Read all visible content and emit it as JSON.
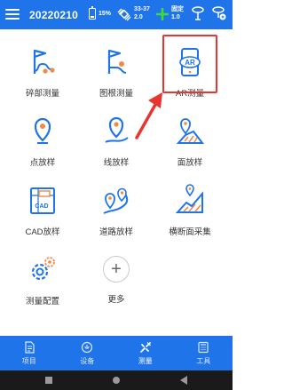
{
  "header": {
    "project_name": "20220210",
    "battery": "15%",
    "satellites": "33-37",
    "sat_value": "2.0",
    "fix_status": "固定",
    "fix_value": "1.0"
  },
  "grid": [
    {
      "label": "碎部测量",
      "icon": "detail-survey-icon"
    },
    {
      "label": "图根测量",
      "icon": "control-survey-icon"
    },
    {
      "label": "AR测量",
      "icon": "ar-survey-icon"
    },
    {
      "label": "点放样",
      "icon": "point-stakeout-icon"
    },
    {
      "label": "线放样",
      "icon": "line-stakeout-icon"
    },
    {
      "label": "面放样",
      "icon": "surface-stakeout-icon"
    },
    {
      "label": "CAD放样",
      "icon": "cad-stakeout-icon"
    },
    {
      "label": "道路放样",
      "icon": "road-stakeout-icon"
    },
    {
      "label": "横断面采集",
      "icon": "cross-section-icon"
    },
    {
      "label": "测量配置",
      "icon": "survey-config-icon"
    },
    {
      "label": "更多",
      "icon": "plus-icon"
    }
  ],
  "ar_icon_text": "AR",
  "cad_icon_text": "CAD",
  "more_symbol": "+",
  "bottom_nav": [
    {
      "label": "项目",
      "icon": "project-icon",
      "active": false
    },
    {
      "label": "设备",
      "icon": "device-icon",
      "active": false
    },
    {
      "label": "测量",
      "icon": "measure-icon",
      "active": true
    },
    {
      "label": "工具",
      "icon": "tools-icon",
      "active": false
    }
  ],
  "colors": {
    "primary": "#1e74e8",
    "icon_blue": "#1e74e8",
    "icon_orange": "#f08a4b",
    "highlight_red": "#e8352f"
  }
}
